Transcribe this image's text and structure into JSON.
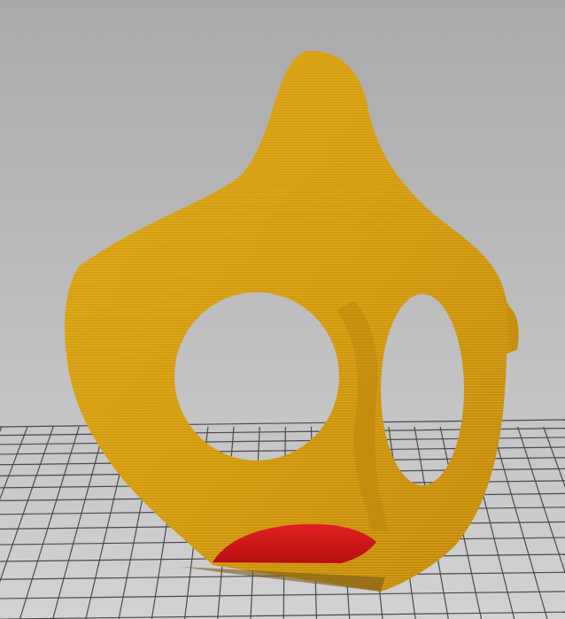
{
  "viewport": {
    "model_name": "",
    "colors": {
      "background_top": "#a9a9a9",
      "background_bottom": "#d2d2d2",
      "grid_line": "#4a4a4a",
      "model_body": "#d39a10",
      "model_highlight": "#e8c02a",
      "model_shadow": "#a8720a",
      "bottom_layer": "#d8161a"
    }
  }
}
